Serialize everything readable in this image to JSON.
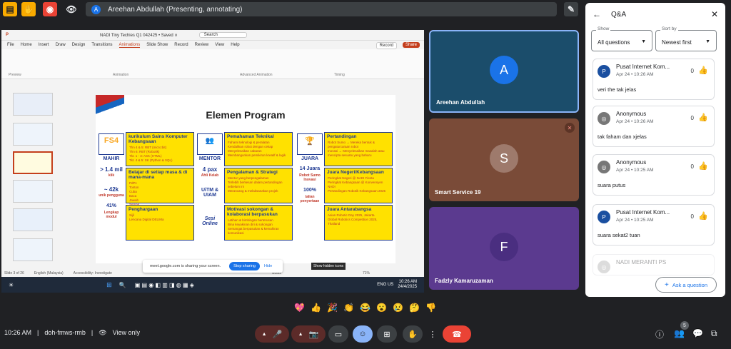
{
  "top": {
    "presenting": "Areehan Abdullah (Presenting, annotating)",
    "avatar_letter": "A"
  },
  "ppt": {
    "title": "NADI Tiny Techies Q1 042425 • Saved ∨",
    "search": "Search",
    "menu": [
      "File",
      "Home",
      "Insert",
      "Draw",
      "Design",
      "Transitions",
      "Animations",
      "Slide Show",
      "Record",
      "Review",
      "View",
      "Help"
    ],
    "active_menu": "Animations",
    "record": "Record",
    "share": "Share",
    "ribbon_groups": [
      "Preview",
      "Animation",
      "Advanced Animation",
      "Timing"
    ],
    "status_left": "Slide 3 of 26",
    "status_lang": "English (Malaysia)",
    "status_acc": "Accessibility: Investigate",
    "status_notes": "Notes",
    "zoom": "71%",
    "tooltip": "Show hidden icons",
    "clock_time": "10:26 AM",
    "clock_date": "24/4/2025",
    "lang": "ENG US"
  },
  "slide": {
    "title": "Elemen Program",
    "mahir": "MAHIR",
    "mentor": "MENTOR",
    "juara": "JUARA",
    "stat1": "> 1.4 mil",
    "stat1b": "klik",
    "stat2": "~ 42k",
    "stat2b": "unik pengguna",
    "stat3": "41%",
    "stat3b": "Lengkap modul",
    "mentor_stat": "4 pax",
    "mentor_stat_b": "Ahli Kelab",
    "uitm": "UiTM & UIAM",
    "sesi": "Sesi Online",
    "juara_stat": "14 Juara",
    "juara_b": "Robot Sumo Inovasi",
    "pct": "100%",
    "pct_b": "talian penyertaan",
    "box1_title": "kurikulum Sains Komputer Kebangsaan",
    "box1_lines": [
      "Thn 4 & 5: RBT (micro:bit)",
      "Thn 6: RBT (Robotik)",
      "Tkt. 1 - 3: ASK (HTML)",
      "Tkt. 4 & 5: SK (Python & SQL)"
    ],
    "box2_title": "Belajar di setiap masa & di mana-mana",
    "box2_lines": [
      "PdPc",
      "Tonton",
      "Cuba",
      "Baca",
      "Jawab",
      "Semak"
    ],
    "box3_title": "Penghargaan",
    "box3_lines": [
      "Sijil",
      "Lencana Digital DELIMa"
    ],
    "box4_title": "Pemahaman Teknikal",
    "box4_lines": [
      "Fahami teknologi & peralatan",
      "Kendalikan robot dengan cekap",
      "Menyelesaikan cabaran",
      "Membangunkan pemikiran kreatif & logik"
    ],
    "box5_title": "Pengalaman & Strategi",
    "box5_lines": [
      "Mentor yang berpengalaman",
      "Terlebih berkesan dalam pertandingan sebelum ini",
      "Merancang & melaksanakan projek"
    ],
    "box6_title": "Motivasi sokongan & kolaborasi berpasukan",
    "box6_lines": [
      "Latihan & bimbingan berterusan",
      "Bina keyakinan diri & sokongan",
      "Semangat berpasukan & kemahiran komunikasi"
    ],
    "box7_title": "Pertandingan",
    "box7_lines": [
      "Robot Sumo → Mereka bentuk & pengaturcaraan robot",
      "Inovasi → Menyelesaikan masalah atau mencipta sesuatu yang baharu"
    ],
    "box8_title": "Juara Negeri/Kebangsaan",
    "box8_lines": [
      "Peringkat Negeri @ NADI Fiesta",
      "Peringkat Kebangsaan @ Konvensyen NADI",
      "Pertandingan Robotik Kebangsaan 2025"
    ],
    "box9_title": "Juara Antarabangsa",
    "box9_lines": [
      "Asian Robotic Day 2025, Jakarta",
      "Global Robotics Competition 2025, Thailand"
    ]
  },
  "share_banner": {
    "text": "meet.google.com is sharing your screen.",
    "stop": "Stop sharing",
    "hide": "Hide"
  },
  "tiles": [
    {
      "name": "Areehan Abdullah",
      "letter": "A",
      "bg": "#1b4d6b",
      "circle": "#1a73e8"
    },
    {
      "name": "Smart Service 19",
      "letter": "S",
      "bg": "#7a4b38",
      "circle": "#9e7a6c"
    },
    {
      "name": "Fadzly Kamaruzaman",
      "letter": "F",
      "bg": "#5b3a8f",
      "circle": "#4a2e80"
    }
  ],
  "qa": {
    "title": "Q&A",
    "show_label": "Show",
    "show_value": "All questions",
    "sort_label": "Sort by",
    "sort_value": "Newest first",
    "questions": [
      {
        "name": "Pusat Internet Kom...",
        "date": "Apr 24 • 10:26 AM",
        "text": "veri the tak jelas",
        "count": "0",
        "letter": "P",
        "color": "#1a4fa0"
      },
      {
        "name": "Anonymous",
        "date": "Apr 24 • 10:26 AM",
        "text": "tak faham dan xjelas",
        "count": "0",
        "letter": "◎",
        "color": "#777"
      },
      {
        "name": "Anonymous",
        "date": "Apr 24 • 10:25 AM",
        "text": "suara putus",
        "count": "0",
        "letter": "◎",
        "color": "#777"
      },
      {
        "name": "Pusat Internet Kom...",
        "date": "Apr 24 • 10:25 AM",
        "text": "suara sekat2 tuan",
        "count": "0",
        "letter": "P",
        "color": "#1a4fa0"
      },
      {
        "name": "NADI MERANTI PS",
        "date": "",
        "text": "",
        "count": "",
        "letter": "◎",
        "color": "#aaa"
      }
    ],
    "ask": "Ask a question"
  },
  "bottom": {
    "time": "10:26 AM",
    "code": "doh-fmws-rmb",
    "view": "View only",
    "reactions": [
      "💖",
      "👍",
      "🎉",
      "👏",
      "😂",
      "😮",
      "😢",
      "🤔",
      "👎"
    ],
    "people_badge": "5"
  }
}
